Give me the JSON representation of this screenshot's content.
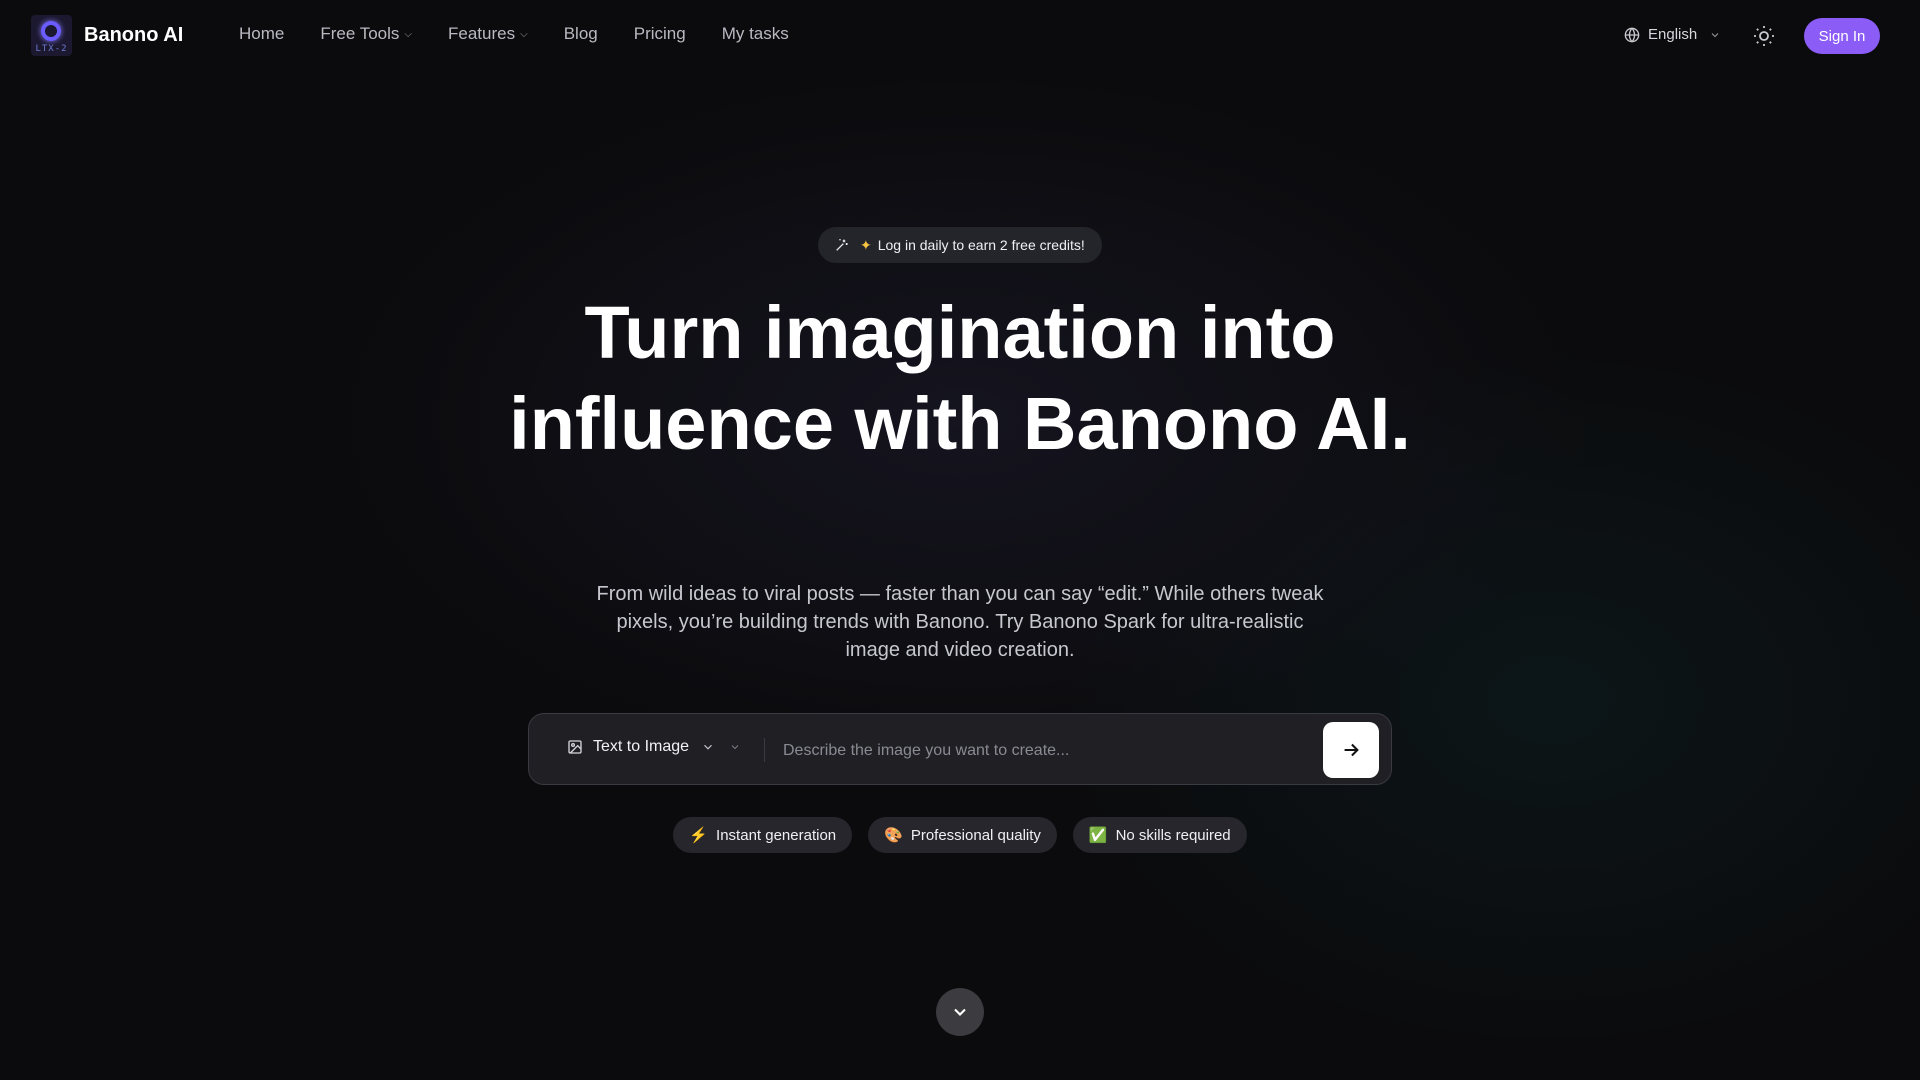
{
  "header": {
    "logo_text": "LTX-2",
    "brand": "Banono AI",
    "nav": [
      {
        "label": "Home",
        "dropdown": false
      },
      {
        "label": "Free Tools",
        "dropdown": true
      },
      {
        "label": "Features",
        "dropdown": true
      },
      {
        "label": "Blog",
        "dropdown": false
      },
      {
        "label": "Pricing",
        "dropdown": false
      },
      {
        "label": "My tasks",
        "dropdown": false
      }
    ],
    "language": "English",
    "signin_label": "Sign In",
    "accent_color": "#8b5cf6"
  },
  "hero": {
    "badge_text": "Log in daily to earn 2 free credits!",
    "title": "Turn imagination into influence with Banono AI.",
    "subtitle": "From wild ideas to viral posts — faster than you can say “edit.” While others tweak pixels, you’re building trends with Banono. Try Banono Spark for ultra-realistic image and video creation."
  },
  "prompt": {
    "mode_label": "Text to Image",
    "placeholder": "Describe the image you want to create...",
    "value": ""
  },
  "chips": [
    {
      "icon": "⚡",
      "label": "Instant generation"
    },
    {
      "icon": "🎨",
      "label": "Professional quality"
    },
    {
      "icon": "✅",
      "label": "No skills required"
    }
  ]
}
